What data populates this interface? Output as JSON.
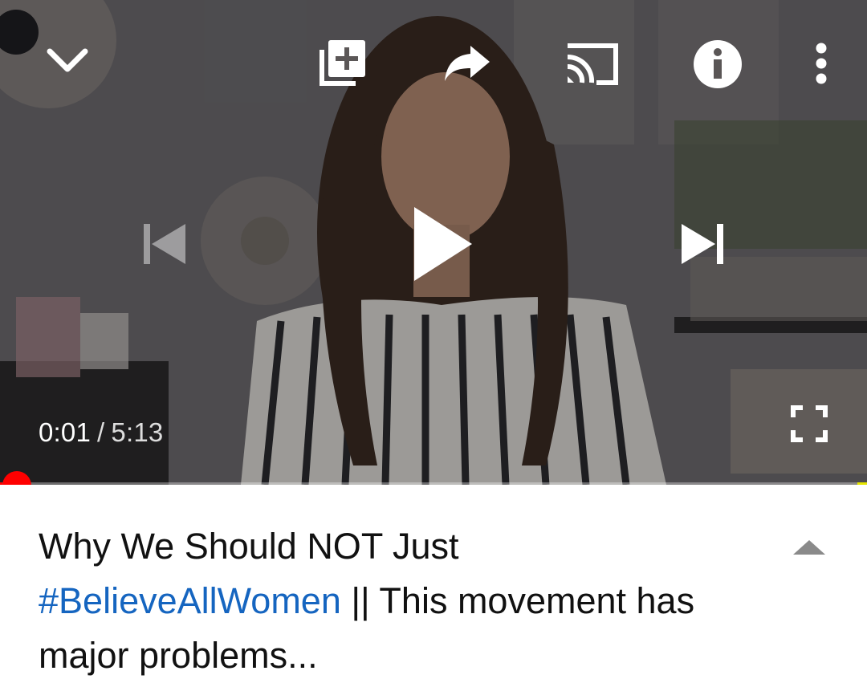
{
  "player": {
    "time_current": "0:01",
    "time_separator": "/",
    "time_total": "5:13",
    "progress_fraction": 0.003,
    "icons": {
      "minimize": "chevron-down-icon",
      "add_to_queue": "add-to-queue-icon",
      "share": "share-icon",
      "cast": "cast-icon",
      "info": "info-icon",
      "more": "more-vert-icon",
      "previous": "skip-previous-icon",
      "play": "play-icon",
      "next": "skip-next-icon",
      "fullscreen": "fullscreen-icon"
    },
    "colors": {
      "progress": "#ff0000",
      "hashtag": "#1565c0"
    }
  },
  "video": {
    "title_hashtag": "#BelieveAllWomen",
    "title_line1": "Why We Should NOT Just",
    "title_rest": " || This movement has major problems..."
  }
}
